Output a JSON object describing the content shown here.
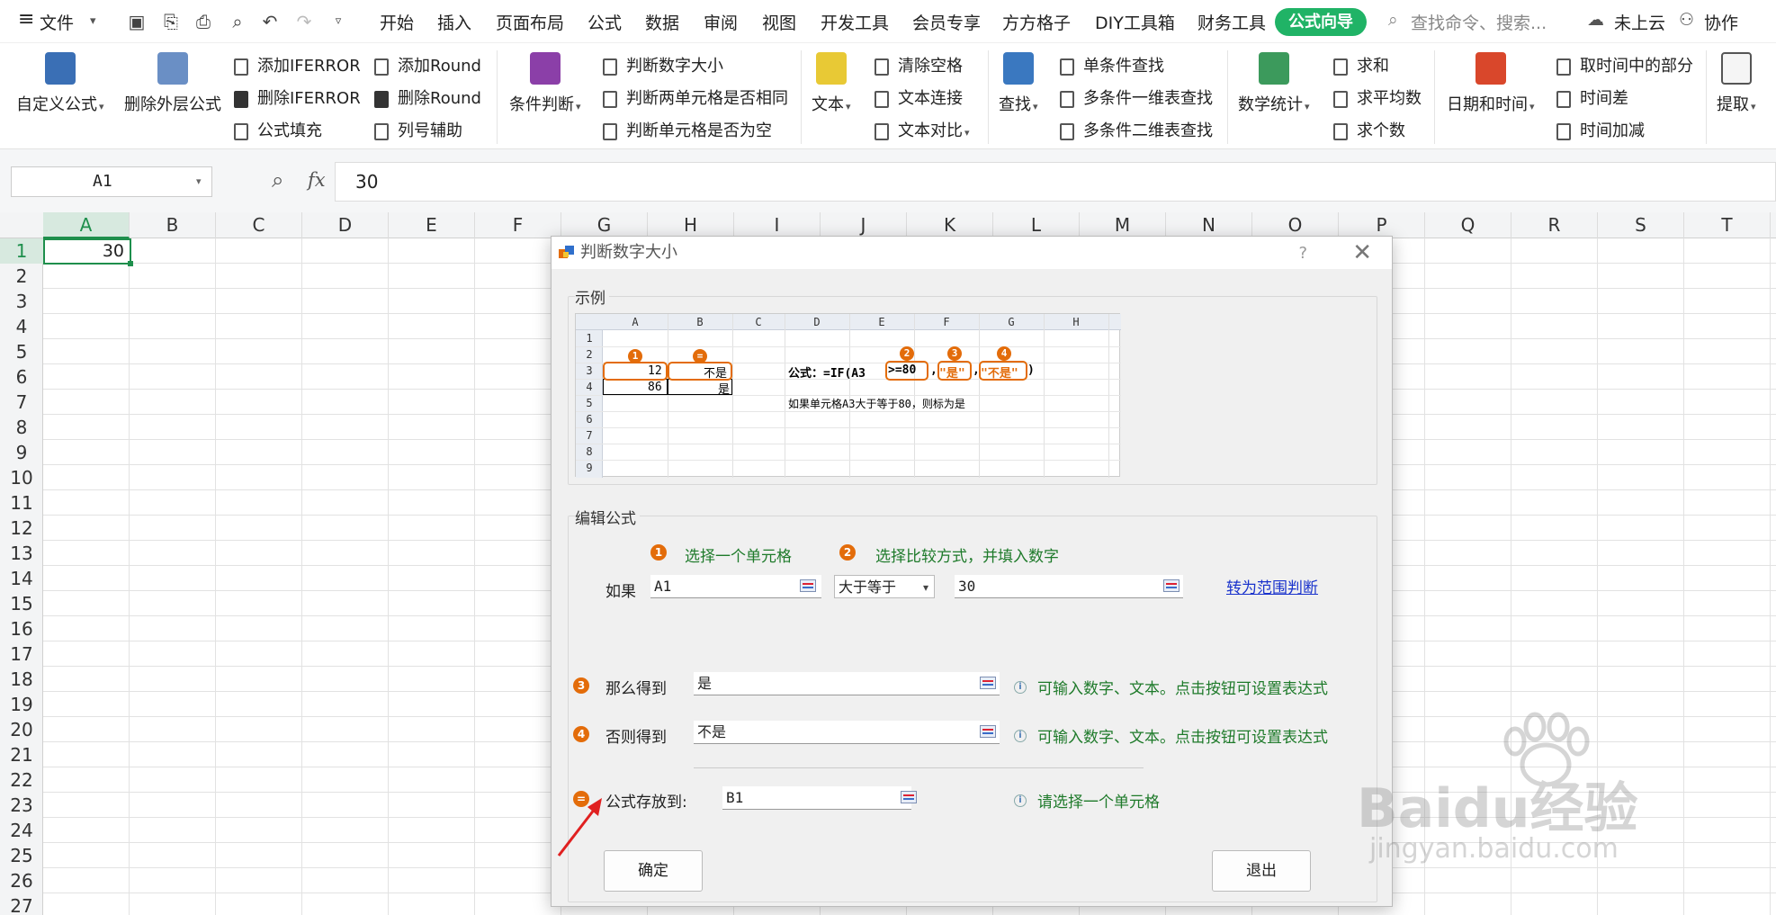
{
  "menu": {
    "file_label": "文件",
    "tabs": [
      "开始",
      "插入",
      "页面布局",
      "公式",
      "数据",
      "审阅",
      "视图",
      "开发工具",
      "会员专享",
      "方方格子",
      "DIY工具箱",
      "财务工具"
    ],
    "active_tab": "公式向导",
    "search_placeholder": "查找命令、搜索...",
    "cloud_label": "未上云",
    "collab_label": "协作"
  },
  "ribbon": {
    "custom_formula": "自定义公式",
    "remove_outer": "删除外层公式",
    "add_iferror": "添加IFERROR",
    "del_iferror": "删除IFERROR",
    "formula_fill": "公式填充",
    "add_round": "添加Round",
    "del_round": "删除Round",
    "col_helper": "列号辅助",
    "condition_judge": "条件判断",
    "judge_num_size": "判断数字大小",
    "judge_two_same": "判断两单元格是否相同",
    "judge_empty": "判断单元格是否为空",
    "text": "文本",
    "clear_space": "清除空格",
    "text_join": "文本连接",
    "text_compare": "文本对比",
    "lookup": "查找",
    "single_lookup": "单条件查找",
    "multi_1d": "多条件一维表查找",
    "multi_2d": "多条件二维表查找",
    "math_stats": "数学统计",
    "sum": "求和",
    "avg": "求平均数",
    "count": "求个数",
    "date_time": "日期和时间",
    "get_time_part": "取时间中的部分",
    "time_diff": "时间差",
    "time_add": "时间加减",
    "extract": "提取"
  },
  "formula_bar": {
    "name_box": "A1",
    "fx_icon": "fx",
    "value": "30"
  },
  "sheet": {
    "columns": [
      "A",
      "B",
      "C",
      "D",
      "E",
      "F",
      "G",
      "H",
      "I",
      "J",
      "K",
      "L",
      "M",
      "N",
      "O",
      "P",
      "Q",
      "R",
      "S",
      "T"
    ],
    "rows": [
      "1",
      "2",
      "3",
      "4",
      "5",
      "6",
      "7",
      "8",
      "9",
      "10",
      "11",
      "12",
      "13",
      "14",
      "15",
      "16",
      "17",
      "18",
      "19",
      "20",
      "21",
      "22",
      "23",
      "24",
      "25",
      "26",
      "27"
    ],
    "a1_value": "30",
    "selected_cell": "A1"
  },
  "dialog": {
    "title": "判断数字大小",
    "help": "?",
    "close": "✕",
    "example_group": "示例",
    "sample": {
      "cols": [
        "A",
        "B",
        "C",
        "D",
        "E",
        "F",
        "G",
        "H"
      ],
      "rows": [
        "1",
        "2",
        "3",
        "4",
        "5",
        "6",
        "7",
        "8",
        "9"
      ],
      "a3": "12",
      "b3": "不是",
      "a4": "86",
      "b4": "是",
      "formula_prefix": "公式：=IF(A3",
      "cond": ">=80",
      "comma": ",",
      "yes": "\"是\"",
      "no": "\"不是\"",
      "close_paren": ")",
      "note": "如果单元格A3大于等于80，则标为是",
      "markers": [
        "1",
        "=",
        "2",
        "3",
        "4"
      ]
    },
    "edit_group": "编辑公式",
    "step1": "选择一个单元格",
    "step2": "选择比较方式，并填入数字",
    "if_label": "如果",
    "cell_ref": "A1",
    "compare_op": "大于等于",
    "compare_val": "30",
    "range_link": "转为范围判断",
    "then_label": "那么得到",
    "then_val": "是",
    "then_hint": "可输入数字、文本。点击按钮可设置表达式",
    "else_label": "否则得到",
    "else_val": "不是",
    "else_hint": "可输入数字、文本。点击按钮可设置表达式",
    "store_label": "公式存放到:",
    "store_val": "B1",
    "store_hint": "请选择一个单元格",
    "ok": "确定",
    "exit": "退出"
  },
  "watermark": {
    "brand": "Baidu经验",
    "url": "jingyan.baidu.com"
  },
  "colors": {
    "accent_green": "#20b366",
    "orange": "#e36c0a",
    "link": "#1a33cc"
  }
}
